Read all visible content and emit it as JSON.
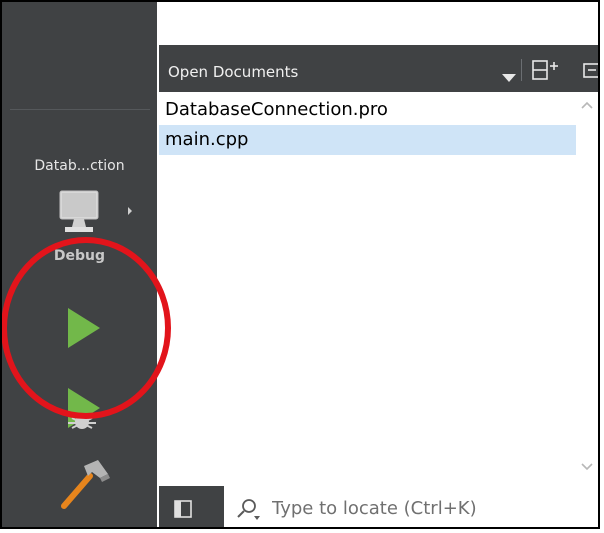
{
  "sidebar": {
    "project_label": "Datab...ction",
    "build_mode_label": "Debug",
    "kit_icon": "monitor-icon",
    "run_icon": "play-icon",
    "debug_icon": "play-bug-icon",
    "build_icon": "hammer-icon",
    "colors": {
      "background": "#404244",
      "run_green": "#72b84a"
    }
  },
  "open_documents": {
    "title": "Open Documents",
    "items": [
      {
        "name": "DatabaseConnection.pro"
      },
      {
        "name": "main.cpp",
        "selected": true
      }
    ]
  },
  "locator": {
    "placeholder": "Type to locate (Ctrl+K)",
    "value": ""
  },
  "annotation": {
    "shape": "circle",
    "color": "#e2141b"
  }
}
